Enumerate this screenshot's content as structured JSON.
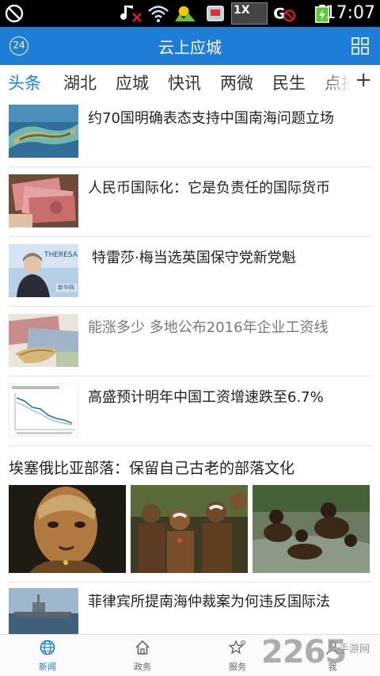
{
  "status_bar": {
    "time": "17:07",
    "icons": [
      "no-disturb-icon",
      "muted-icon",
      "wifi-icon",
      "weather-icon",
      "sim-icon",
      "sim2-icon",
      "no-sync-icon",
      "battery-charging-icon"
    ],
    "sim_label": "1X"
  },
  "header": {
    "title": "云上应城",
    "badge": "24",
    "menu_icon": "grid-menu-icon"
  },
  "tabs": {
    "items": [
      {
        "label": "头条",
        "active": true
      },
      {
        "label": "湖北",
        "active": false
      },
      {
        "label": "应城",
        "active": false
      },
      {
        "label": "快讯",
        "active": false
      },
      {
        "label": "两微",
        "active": false
      },
      {
        "label": "民生",
        "active": false
      },
      {
        "label": "点播",
        "active": false
      }
    ],
    "add_label": "+"
  },
  "news": [
    {
      "headline": "约70国明确表态支持中国南海问题立场",
      "image": "island-photo"
    },
    {
      "headline": "人民币国际化：它是负责任的国际货币",
      "image": "rmb-banknotes-photo"
    },
    {
      "headline": "特雷莎·梅当选英国保守党新党魁",
      "image": "theresa-may-photo",
      "image_caption": "THERESA MA",
      "image_sub": "新华网"
    },
    {
      "headline": "能涨多少 多地公布2016年企业工资线",
      "image": "banknotes-photo",
      "read": true
    },
    {
      "headline": "高盛预计明年中国工资增速跌至6.7%",
      "image": "line-chart-thumbnail"
    }
  ],
  "gallery": {
    "title": "埃塞俄比亚部落：保留自己古老的部落文化",
    "images": [
      "painted-face-photo",
      "tribe-group-photo",
      "river-children-photo"
    ]
  },
  "last_news": {
    "headline": "菲律宾所提南海仲裁案为何违反国际法",
    "image": "warship-photo"
  },
  "bottom_nav": {
    "items": [
      {
        "label": "新闻",
        "icon": "globe-icon",
        "active": true
      },
      {
        "label": "政务",
        "icon": "home-icon",
        "active": false
      },
      {
        "label": "服务",
        "icon": "star-icon",
        "active": false
      },
      {
        "label": "我",
        "icon": "user-icon",
        "active": false
      }
    ]
  },
  "watermark": {
    "big": "2265",
    "small": "手游网"
  },
  "colors": {
    "accent": "#1e7ed6",
    "status_bar": "#000000",
    "read_text": "#777777"
  }
}
